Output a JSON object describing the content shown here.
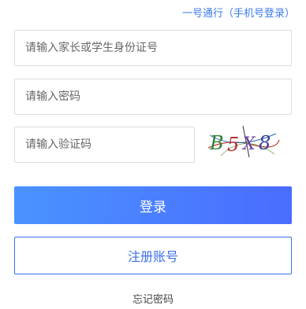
{
  "header": {
    "oneid_login_link": "一号通行（手机号登录）"
  },
  "form": {
    "username_placeholder": "请输入家长或学生身份证号",
    "password_placeholder": "请输入密码",
    "captcha_placeholder": "请输入验证码",
    "captcha_text": "B5X8"
  },
  "actions": {
    "login_label": "登录",
    "register_label": "注册账号",
    "forgot_label": "忘记密码"
  }
}
